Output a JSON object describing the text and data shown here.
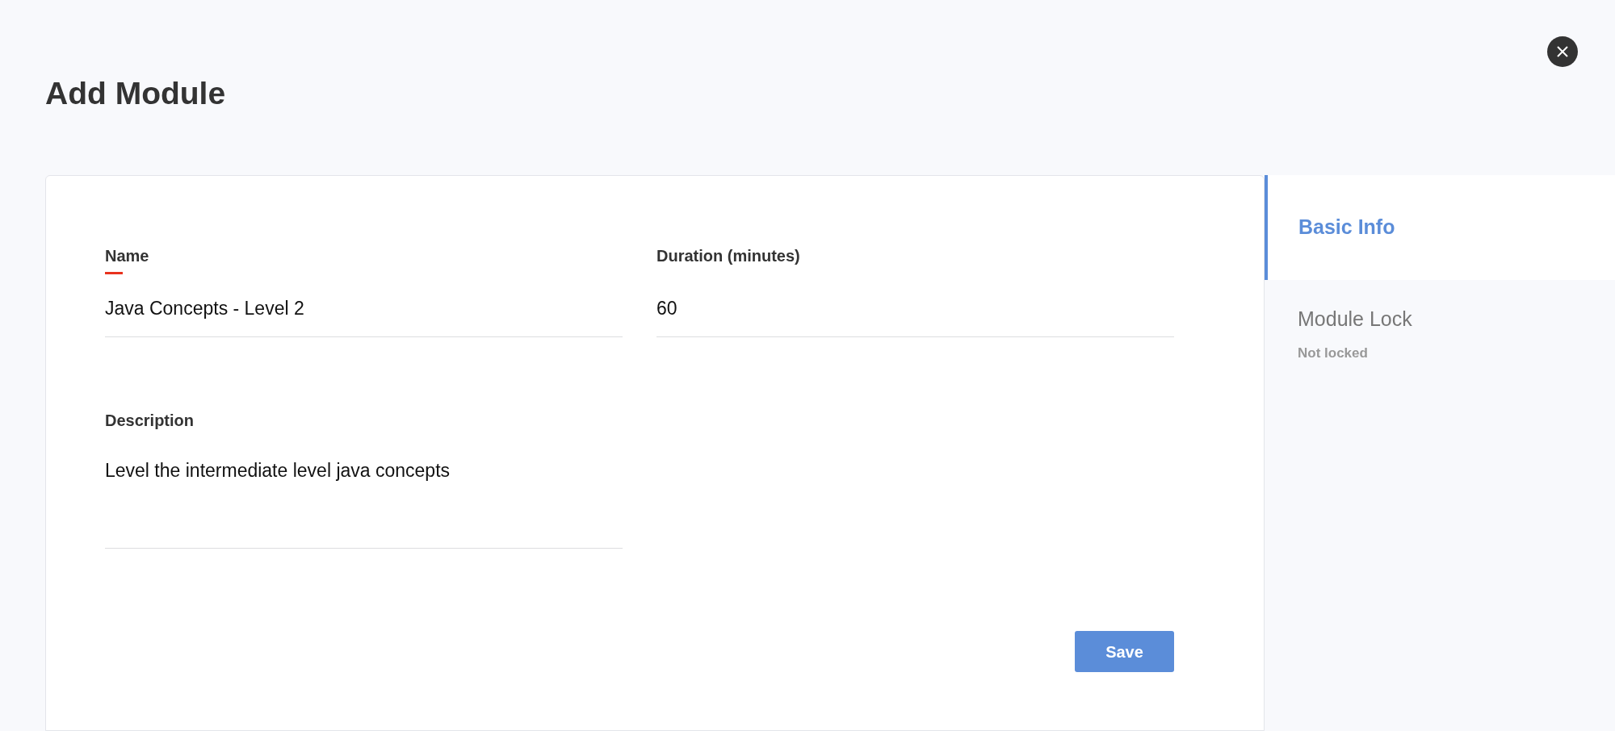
{
  "title": "Add Module",
  "fields": [
    {
      "label": "Name",
      "value": "Java Concepts - Level 2",
      "required": true
    },
    {
      "label": "Duration (minutes)",
      "value": "60",
      "required": false
    },
    {
      "label": "Description",
      "value": "Level the intermediate level java concepts",
      "required": false,
      "kind": "textarea"
    }
  ],
  "save_button": "Save",
  "tabs": [
    {
      "label": "Basic Info",
      "selected": true
    },
    {
      "label": "Module Lock",
      "subtitle": "Not locked",
      "selected": false
    }
  ]
}
